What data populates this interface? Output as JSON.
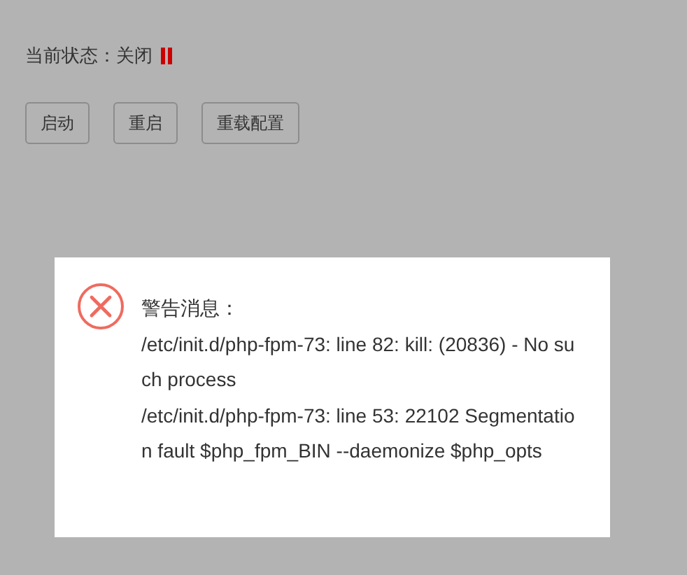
{
  "status": {
    "label": "当前状态：",
    "value": "关闭",
    "running": false
  },
  "buttons": [
    {
      "label": "启动"
    },
    {
      "label": "重启"
    },
    {
      "label": "重载配置"
    }
  ],
  "dialog": {
    "kind": "error",
    "title": "警告消息：",
    "lines": [
      "/etc/init.d/php-fpm-73: line 82: kill: (20836) - No such process",
      "/etc/init.d/php-fpm-73: line 53: 22102 Segmentation fault $php_fpm_BIN --daemonize $php_opts"
    ]
  }
}
